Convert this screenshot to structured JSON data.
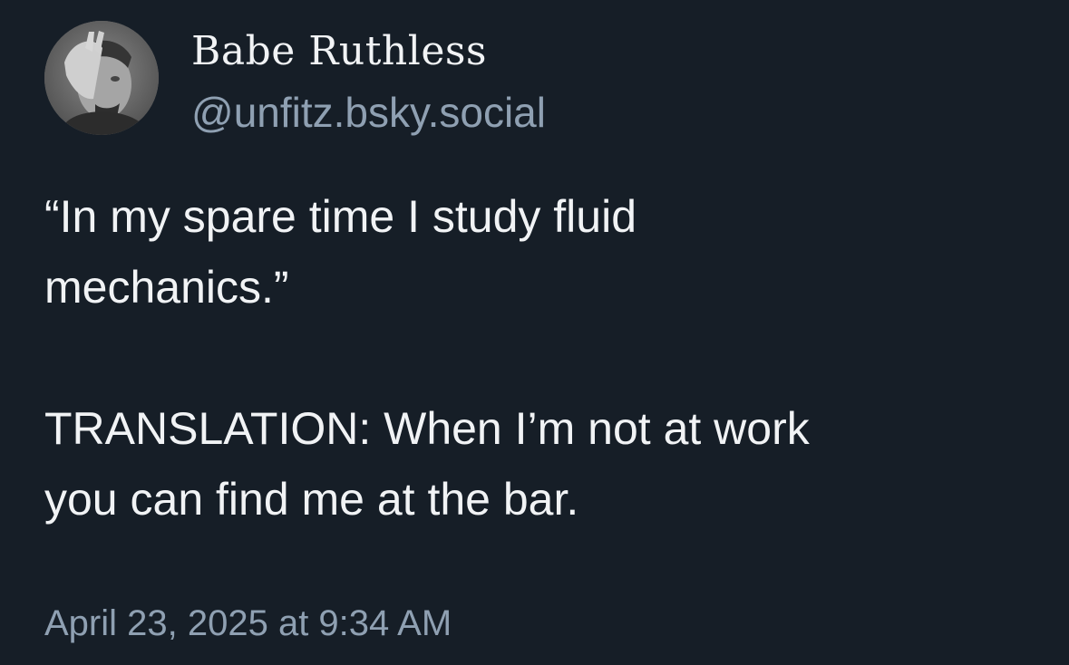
{
  "author": {
    "display_name": "Babe Ruthless",
    "handle": "@unfitz.bsky.social",
    "avatar": "profile-photo"
  },
  "post": {
    "lines": [
      "“In my spare time I study fluid",
      "mechanics.”",
      "TRANSLATION: When I’m not at work",
      "you can find me at the bar."
    ],
    "timestamp": "April 23, 2025 at 9:34 AM"
  },
  "colors": {
    "background": "#161e27",
    "text": "#f1f3f5",
    "muted": "#8fa0b2"
  }
}
